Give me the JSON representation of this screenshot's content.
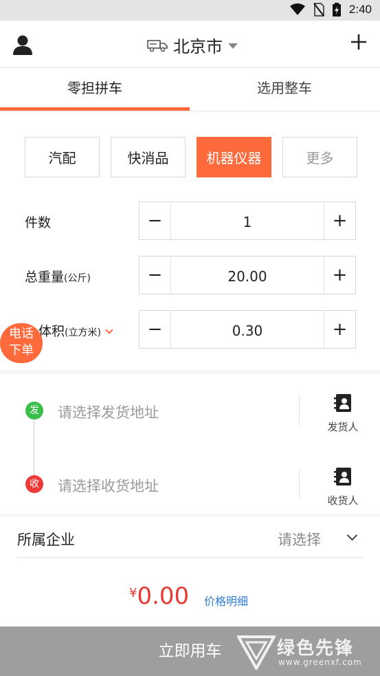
{
  "status_bar": {
    "time": "2:40",
    "icons": [
      "wifi-icon",
      "no-sim-icon",
      "battery-icon"
    ]
  },
  "header": {
    "city": "北京市",
    "left_icon": "user-icon",
    "right_icon": "plus-icon",
    "city_icon": "truck-icon"
  },
  "tabs": [
    {
      "label": "零担拼车",
      "active": true
    },
    {
      "label": "选用整车",
      "active": false
    }
  ],
  "categories": [
    {
      "label": "汽配",
      "active": false
    },
    {
      "label": "快消品",
      "active": false
    },
    {
      "label": "机器仪器",
      "active": true
    },
    {
      "label": "更多",
      "active": false
    }
  ],
  "fields": {
    "count": {
      "label": "件数",
      "value": "1"
    },
    "weight": {
      "label": "总重量",
      "unit": "(公斤)",
      "value": "20.00"
    },
    "volume": {
      "label": "体积",
      "unit": "(立方米)",
      "value": "0.30"
    }
  },
  "stepper": {
    "minus": "−",
    "plus": "+"
  },
  "call_order": {
    "line1": "电话",
    "line2": "下单"
  },
  "address": {
    "from_tag": "发",
    "to_tag": "收",
    "from_placeholder": "请选择发货地址",
    "to_placeholder": "请选择收货地址",
    "sender_label": "发货人",
    "receiver_label": "收货人"
  },
  "company": {
    "label": "所属企业",
    "select_placeholder": "请选择"
  },
  "price": {
    "currency": "¥",
    "amount": "0.00",
    "detail_link": "价格明细"
  },
  "submit_label": "立即用车",
  "watermark": {
    "title": "绿色先锋",
    "url": "www.greenxf.com"
  },
  "colors": {
    "accent": "#ff6a3d",
    "price": "#e8382f",
    "link": "#2f7fd8",
    "from_dot": "#3cbf4a",
    "to_dot": "#ee3a3a",
    "submit_bg": "#9e9e9e"
  }
}
